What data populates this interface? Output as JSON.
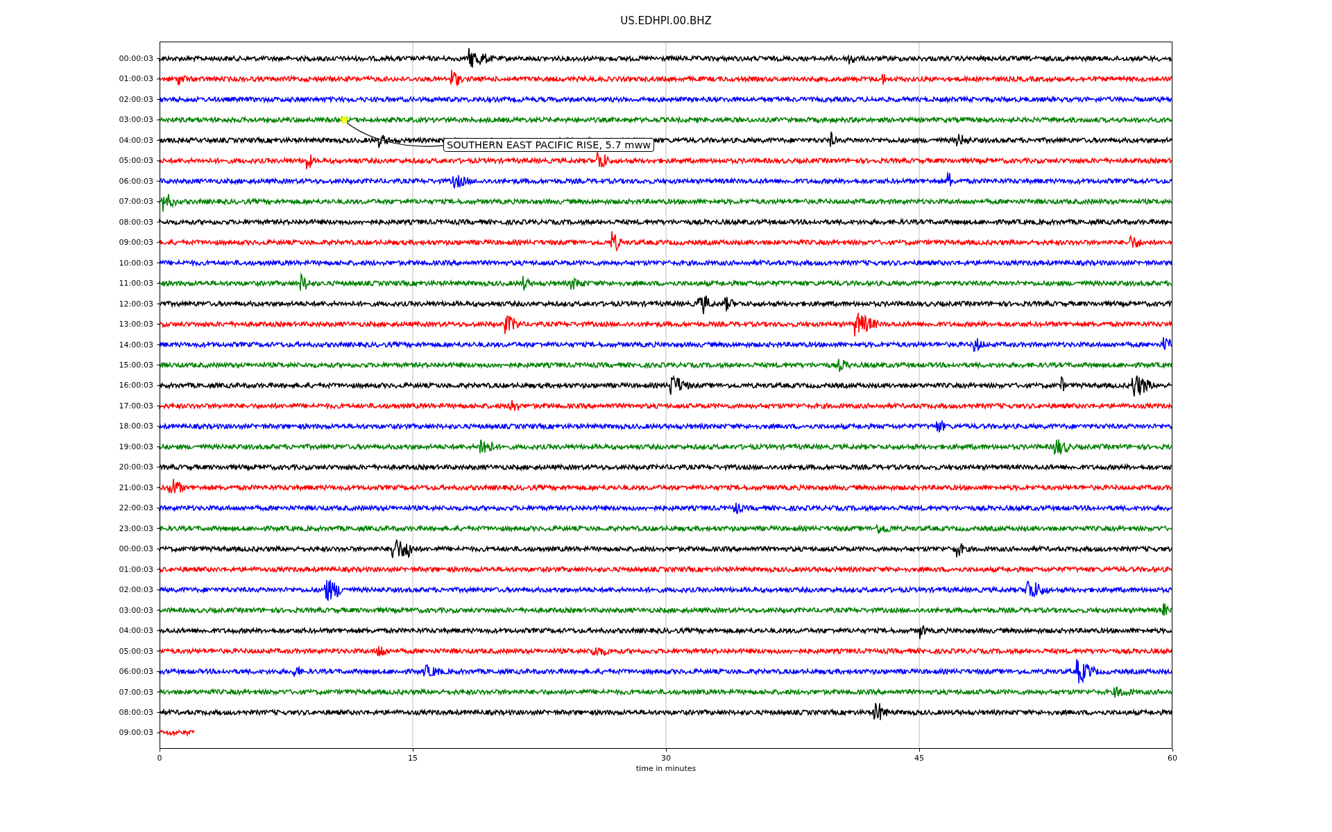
{
  "title": "US.EDHPI.00.BHZ",
  "rows": [
    {
      "label": "00:00:03",
      "color": "#000000",
      "partial": false
    },
    {
      "label": "01:00:03",
      "color": "#ff0000",
      "partial": false
    },
    {
      "label": "02:00:03",
      "color": "#0000ff",
      "partial": false
    },
    {
      "label": "03:00:03",
      "color": "#008000",
      "partial": false
    },
    {
      "label": "04:00:03",
      "color": "#000000",
      "partial": false
    },
    {
      "label": "05:00:03",
      "color": "#ff0000",
      "partial": false
    },
    {
      "label": "06:00:03",
      "color": "#0000ff",
      "partial": false
    },
    {
      "label": "07:00:03",
      "color": "#008000",
      "partial": false
    },
    {
      "label": "08:00:03",
      "color": "#000000",
      "partial": false
    },
    {
      "label": "09:00:03",
      "color": "#ff0000",
      "partial": false
    },
    {
      "label": "10:00:03",
      "color": "#0000ff",
      "partial": false
    },
    {
      "label": "11:00:03",
      "color": "#008000",
      "partial": false
    },
    {
      "label": "12:00:03",
      "color": "#000000",
      "partial": false
    },
    {
      "label": "13:00:03",
      "color": "#ff0000",
      "partial": false
    },
    {
      "label": "14:00:03",
      "color": "#0000ff",
      "partial": false
    },
    {
      "label": "15:00:03",
      "color": "#008000",
      "partial": false
    },
    {
      "label": "16:00:03",
      "color": "#000000",
      "partial": false
    },
    {
      "label": "17:00:03",
      "color": "#ff0000",
      "partial": false
    },
    {
      "label": "18:00:03",
      "color": "#0000ff",
      "partial": false
    },
    {
      "label": "19:00:03",
      "color": "#008000",
      "partial": false
    },
    {
      "label": "20:00:03",
      "color": "#000000",
      "partial": false
    },
    {
      "label": "21:00:03",
      "color": "#ff0000",
      "partial": false
    },
    {
      "label": "22:00:03",
      "color": "#0000ff",
      "partial": false
    },
    {
      "label": "23:00:03",
      "color": "#008000",
      "partial": false
    },
    {
      "label": "00:00:03",
      "color": "#000000",
      "partial": false
    },
    {
      "label": "01:00:03",
      "color": "#ff0000",
      "partial": false
    },
    {
      "label": "02:00:03",
      "color": "#0000ff",
      "partial": false
    },
    {
      "label": "03:00:03",
      "color": "#008000",
      "partial": false
    },
    {
      "label": "04:00:03",
      "color": "#000000",
      "partial": false
    },
    {
      "label": "05:00:03",
      "color": "#ff0000",
      "partial": false
    },
    {
      "label": "06:00:03",
      "color": "#0000ff",
      "partial": false
    },
    {
      "label": "07:00:03",
      "color": "#008000",
      "partial": false
    },
    {
      "label": "08:00:03",
      "color": "#000000",
      "partial": false
    },
    {
      "label": "09:00:03",
      "color": "#ff0000",
      "partial": true
    }
  ],
  "x_axis": {
    "label": "time in minutes",
    "ticks": [
      "0",
      "15",
      "30",
      "45",
      "60"
    ]
  },
  "annotation": {
    "text": "SOUTHERN EAST PACIFIC RISE, 5.7 mww"
  }
}
